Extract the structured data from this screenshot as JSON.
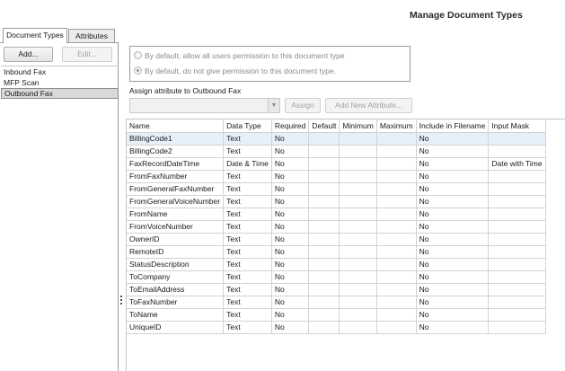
{
  "page_title": "Manage Document Types",
  "tabs": [
    {
      "label": "Document Types",
      "active": true
    },
    {
      "label": "Attributes",
      "active": false
    }
  ],
  "toolbar": {
    "add_label": "Add...",
    "edit_label": "Edit..."
  },
  "document_types": [
    {
      "label": "Inbound Fax",
      "selected": false
    },
    {
      "label": "MFP Scan",
      "selected": false
    },
    {
      "label": "Outbound Fax",
      "selected": true
    }
  ],
  "permissions": {
    "allow_label": "By default, allow all users permission to this document type",
    "deny_label": "By default, do not give permission to this document type.",
    "selected": "deny"
  },
  "assign": {
    "label": "Assign attribute to Outbound Fax",
    "select_value": "",
    "assign_label": "Assign",
    "add_new_label": "Add New Attribute..."
  },
  "grid": {
    "columns": [
      "Name",
      "Data Type",
      "Required",
      "Default",
      "Minimum",
      "Maximum",
      "Include in Filename",
      "Input Mask"
    ],
    "rows": [
      [
        "BillingCode1",
        "Text",
        "No",
        "",
        "",
        "",
        "No",
        ""
      ],
      [
        "BillingCode2",
        "Text",
        "No",
        "",
        "",
        "",
        "No",
        ""
      ],
      [
        "FaxRecordDateTime",
        "Date & Time",
        "No",
        "",
        "",
        "",
        "No",
        "Date with Time"
      ],
      [
        "FromFaxNumber",
        "Text",
        "No",
        "",
        "",
        "",
        "No",
        ""
      ],
      [
        "FromGeneralFaxNumber",
        "Text",
        "No",
        "",
        "",
        "",
        "No",
        ""
      ],
      [
        "FromGeneralVoiceNumber",
        "Text",
        "No",
        "",
        "",
        "",
        "No",
        ""
      ],
      [
        "FromName",
        "Text",
        "No",
        "",
        "",
        "",
        "No",
        ""
      ],
      [
        "FromVoiceNumber",
        "Text",
        "No",
        "",
        "",
        "",
        "No",
        ""
      ],
      [
        "OwnerID",
        "Text",
        "No",
        "",
        "",
        "",
        "No",
        ""
      ],
      [
        "RemoteID",
        "Text",
        "No",
        "",
        "",
        "",
        "No",
        ""
      ],
      [
        "StatusDescription",
        "Text",
        "No",
        "",
        "",
        "",
        "No",
        ""
      ],
      [
        "ToCompany",
        "Text",
        "No",
        "",
        "",
        "",
        "No",
        ""
      ],
      [
        "ToEmailAddress",
        "Text",
        "No",
        "",
        "",
        "",
        "No",
        ""
      ],
      [
        "ToFaxNumber",
        "Text",
        "No",
        "",
        "",
        "",
        "No",
        ""
      ],
      [
        "ToName",
        "Text",
        "No",
        "",
        "",
        "",
        "No",
        ""
      ],
      [
        "UniqueID",
        "Text",
        "No",
        "",
        "",
        "",
        "No",
        ""
      ]
    ],
    "selected_row": 0
  }
}
